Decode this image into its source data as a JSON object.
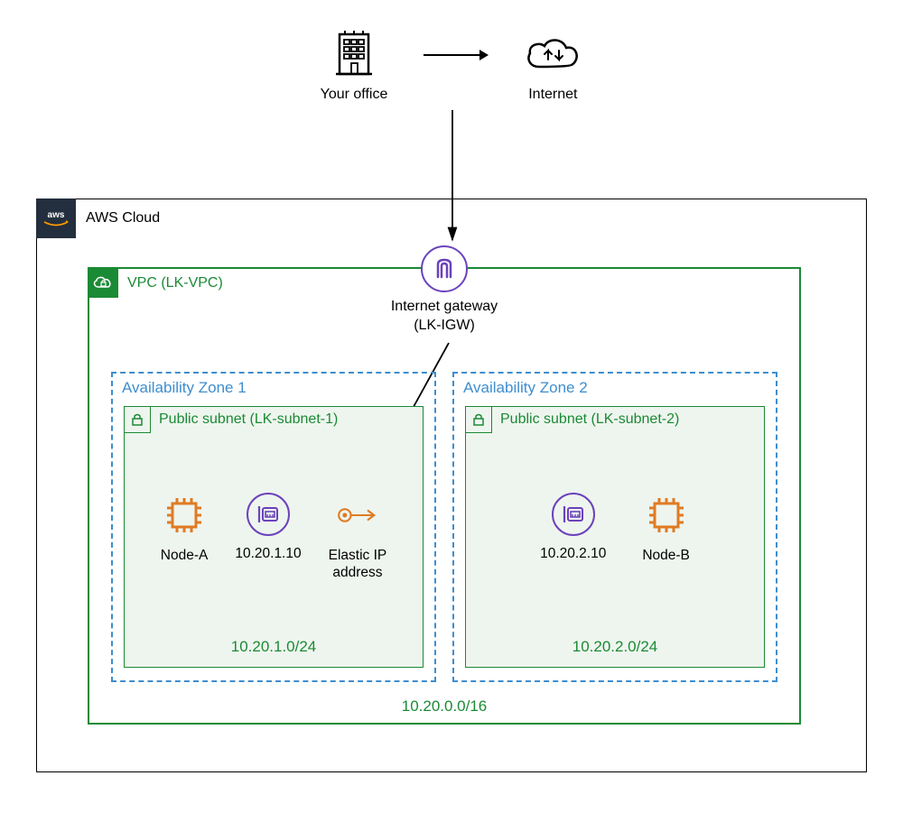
{
  "top": {
    "office_label": "Your office",
    "internet_label": "Internet"
  },
  "aws": {
    "title": "AWS Cloud"
  },
  "vpc": {
    "title": "VPC (LK-VPC)",
    "cidr": "10.20.0.0/16"
  },
  "igw": {
    "label_line1": "Internet gateway",
    "label_line2": "(LK-IGW)"
  },
  "az1": {
    "title": "Availability Zone 1",
    "subnet_title": "Public subnet (LK-subnet-1)",
    "subnet_cidr": "10.20.1.0/24",
    "node_label": "Node-A",
    "eni_label": "10.20.1.10",
    "eip_label_line1": "Elastic IP",
    "eip_label_line2": "address"
  },
  "az2": {
    "title": "Availability Zone 2",
    "subnet_title": "Public subnet (LK-subnet-2)",
    "subnet_cidr": "10.20.2.0/24",
    "node_label": "Node-B",
    "eni_label": "10.20.2.10"
  },
  "colors": {
    "green": "#1b8a35",
    "blue": "#3e8ecf",
    "purple": "#6b42bc",
    "orange": "#e07b24",
    "awsbg": "#232f3e"
  }
}
